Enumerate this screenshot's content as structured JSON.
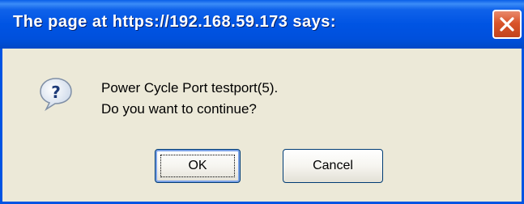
{
  "dialog": {
    "title": "The page at https://192.168.59.173 says:",
    "message_lines": [
      "Power Cycle Port testport(5).",
      "Do you want to continue?"
    ],
    "icon": "question-icon",
    "buttons": {
      "ok_label": "OK",
      "cancel_label": "Cancel"
    }
  },
  "colors": {
    "titlebar": "#0054e3",
    "dialog_bg": "#ece9d8",
    "close_button": "#d9542b",
    "title_text": "#ffffff"
  }
}
